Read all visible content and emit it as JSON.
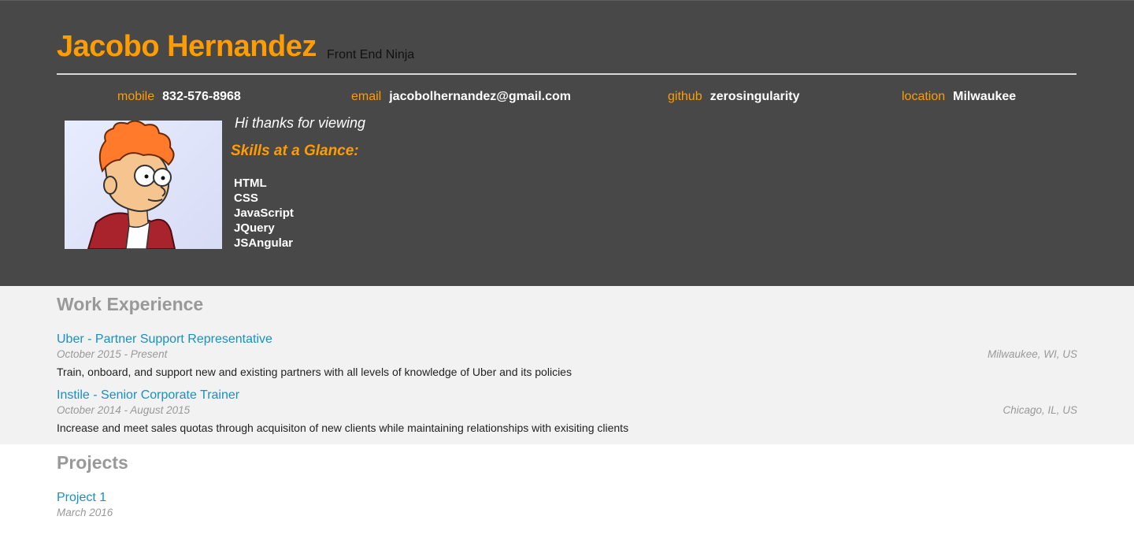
{
  "header": {
    "name": "Jacobo Hernandez",
    "tagline": "Front End Ninja",
    "contacts": [
      {
        "label": "mobile",
        "value": "832-576-8968"
      },
      {
        "label": "email",
        "value": "jacobolhernandez@gmail.com"
      },
      {
        "label": "github",
        "value": "zerosingularity"
      },
      {
        "label": "location",
        "value": "Milwaukee"
      }
    ],
    "greeting": "Hi thanks for viewing",
    "skills_title": "Skills at a Glance:",
    "skills": [
      "HTML",
      "CSS",
      "JavaScript",
      "JQuery",
      "JSAngular"
    ]
  },
  "work": {
    "title": "Work Experience",
    "jobs": [
      {
        "title": "Uber - Partner Support Representative",
        "dates": "October 2015 - Present",
        "location": "Milwaukee, WI, US",
        "description": "Train, onboard, and support new and existing partners with all levels of knowledge of Uber and its policies"
      },
      {
        "title": "Instile - Senior Corporate Trainer",
        "dates": "October 2014 - August 2015",
        "location": "Chicago, IL, US",
        "description": "Increase and meet sales quotas through acquisiton of new clients while maintaining relationships with exisiting clients"
      }
    ]
  },
  "projects": {
    "title": "Projects",
    "items": [
      {
        "title": "Project 1",
        "date": "March 2016"
      }
    ]
  },
  "colors": {
    "accent": "#ff9d00",
    "header_bg": "#484848",
    "link": "#1a8fc0",
    "muted": "#999999",
    "section_bg": "#f2f2f2"
  },
  "icons": {
    "avatar": "cartoon-portrait-avatar"
  }
}
